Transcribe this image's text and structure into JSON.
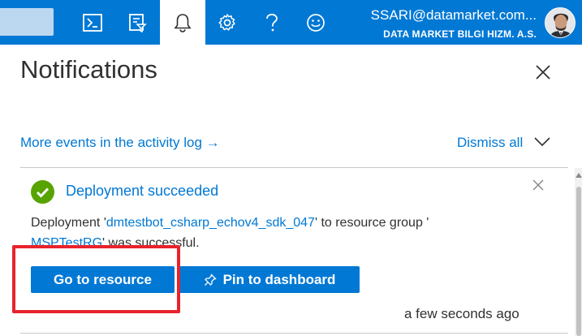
{
  "topbar": {
    "background": "#0078d4",
    "search_placeholder": "",
    "icons": [
      "cloud-shell-icon",
      "directory-filter-icon",
      "bell-icon",
      "gear-icon",
      "help-icon",
      "feedback-smiley-icon"
    ],
    "active_icon": "bell-icon",
    "account": {
      "email": "SSARI@datamarket.com...",
      "organization": "DATA MARKET BILGI HIZM. A.S."
    }
  },
  "panel": {
    "title": "Notifications",
    "activity_link": "More events in the activity log →",
    "dismiss_all": "Dismiss all"
  },
  "notification": {
    "status": "success",
    "status_color": "#57a300",
    "title": "Deployment succeeded",
    "body_prefix": "Deployment '",
    "deployment_name": "dmtestbot_csharp_echov4_sdk_047",
    "body_middle": "' to resource group '",
    "resource_group": "MSPTestRG",
    "body_suffix": "' was successful.",
    "go_to_resource": "Go to resource",
    "pin_to_dashboard": "Pin to dashboard",
    "timestamp": "a few seconds ago"
  },
  "colors": {
    "accent": "#0078d4",
    "highlight": "#e8232d",
    "text": "#323130"
  }
}
